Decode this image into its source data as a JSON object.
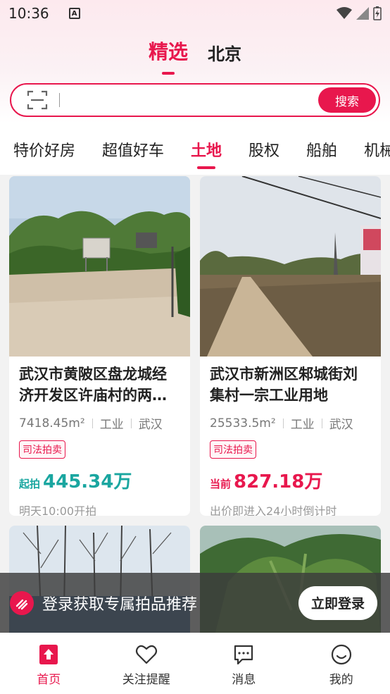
{
  "status_bar": {
    "time": "10:36",
    "notification": "A"
  },
  "top_tabs": [
    {
      "label": "精选",
      "active": true
    },
    {
      "label": "北京",
      "active": false
    }
  ],
  "search": {
    "placeholder": "",
    "button_label": "搜索"
  },
  "categories": [
    {
      "label": "特价好房",
      "active": false
    },
    {
      "label": "超值好车",
      "active": false
    },
    {
      "label": "土地",
      "active": true
    },
    {
      "label": "股权",
      "active": false
    },
    {
      "label": "船舶",
      "active": false
    },
    {
      "label": "机械",
      "active": false
    }
  ],
  "listings": [
    {
      "title": "武汉市黄陂区盘龙城经济开发区许庙村的两…",
      "area": "7418.45m²",
      "usage": "工业",
      "city": "武汉",
      "tag": "司法拍卖",
      "price_prefix": "起拍",
      "price": "445.34万",
      "price_color": "#1aa6a0",
      "note": "明天10:00开拍"
    },
    {
      "title": "武汉市新洲区邾城街刘集村一宗工业用地",
      "area": "25533.5m²",
      "usage": "工业",
      "city": "武汉",
      "tag": "司法拍卖",
      "price_prefix": "当前",
      "price": "827.18万",
      "price_color": "#e8174d",
      "note": "出价即进入24小时倒计时"
    }
  ],
  "login_banner": {
    "text": "登录获取专属拍品推荐",
    "button_label": "立即登录"
  },
  "bottom_nav": [
    {
      "label": "首页",
      "icon": "home-icon",
      "active": true
    },
    {
      "label": "关注提醒",
      "icon": "heart-icon",
      "active": false
    },
    {
      "label": "消息",
      "icon": "message-icon",
      "active": false
    },
    {
      "label": "我的",
      "icon": "profile-icon",
      "active": false
    }
  ],
  "colors": {
    "accent": "#e8174d",
    "teal": "#1aa6a0"
  }
}
